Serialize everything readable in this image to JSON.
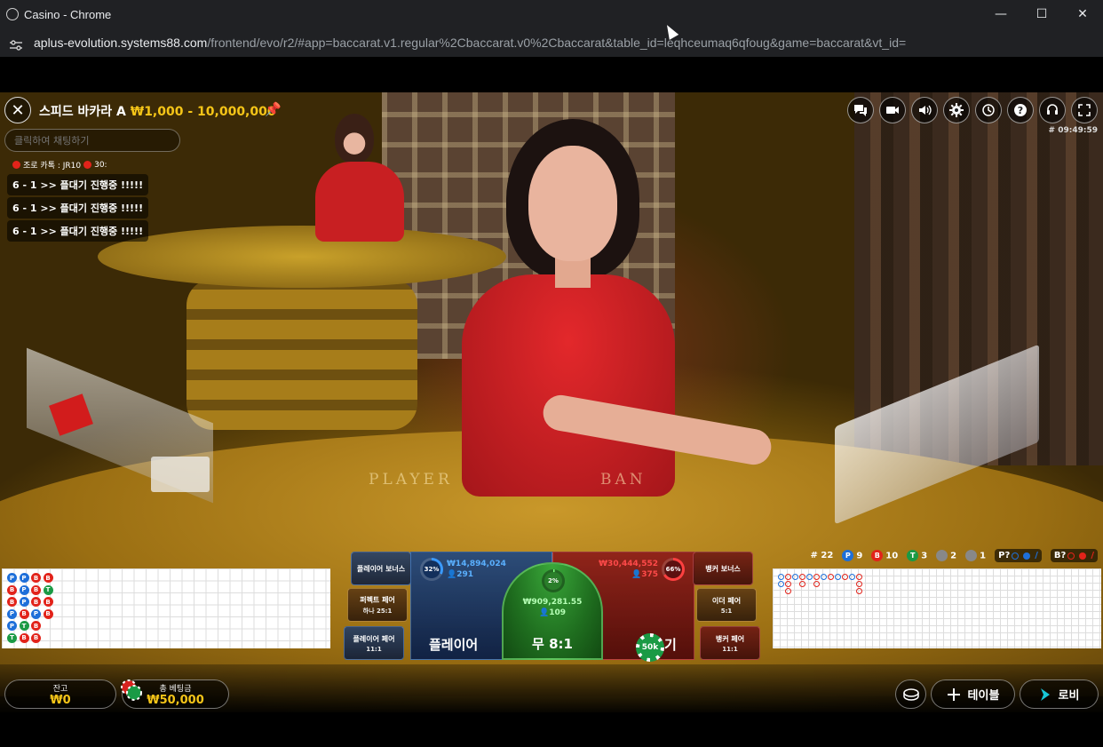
{
  "window": {
    "title": "Casino - Chrome",
    "minimize": "—",
    "maximize": "☐",
    "close": "✕"
  },
  "address": {
    "host": "aplus-evolution.systems88.com",
    "path": "/frontend/evo/r2/#app=baccarat.v1.regular%2Cbaccarat.v0%2Cbaccarat&table_id=leqhceumaq6qfoug&game=baccarat&vt_id="
  },
  "table": {
    "name": "스피드 바카라 A",
    "limits": "₩1,000 - 10,000,000",
    "game_id": "# 09:49:59"
  },
  "chat": {
    "placeholder": "클릭하여 채팅하기",
    "header_name": "조로 카톡 : JR10",
    "header_suffix": "30:",
    "messages": [
      "6 - 1 >> 플대기 진행중 !!!!!",
      "6 - 1 >> 플대기 진행중 !!!!!",
      "6 - 1 >> 플대기 진행중 !!!!!"
    ]
  },
  "toolbar_icons": [
    "chat-icon",
    "video-icon",
    "sound-icon",
    "settings-icon",
    "history-icon",
    "help-icon",
    "support-icon",
    "fullscreen-icon"
  ],
  "table_text": {
    "player": "PLAYER",
    "banker": "BAN"
  },
  "stats": {
    "round": "# 22",
    "player_count": "9",
    "banker_count": "10",
    "tie_count": "3",
    "player_pair": "2",
    "banker_pair": "1",
    "player_predict": "P?",
    "banker_predict": "B?",
    "p_letter": "P",
    "b_letter": "B",
    "t_letter": "T"
  },
  "bead_road": [
    [
      "P",
      "P",
      "B",
      "B"
    ],
    [
      "B",
      "P",
      "B",
      "T"
    ],
    [
      "B",
      "P",
      "B",
      "B"
    ],
    [
      "P",
      "B",
      "P",
      "B"
    ],
    [
      "P",
      "T",
      "B"
    ],
    [
      "T",
      "B",
      "B"
    ]
  ],
  "bets": {
    "player_bonus": "플레이어 보너스",
    "perfect_pair": "퍼펙트 페어",
    "perfect_pair_odds": "하나 25:1",
    "player_pair": "플레이어 페어",
    "player_pair_odds": "11:1",
    "banker_bonus": "뱅커 보너스",
    "either_pair": "이더 페어",
    "either_pair_odds": "5:1",
    "banker_pair": "뱅커 페어",
    "banker_pair_odds": "11:1",
    "player_label": "플레이어",
    "player_pct": "32%",
    "player_amount": "₩14,894,024",
    "player_bettors": "291",
    "tie_label": "무 8:1",
    "tie_pct": "2%",
    "tie_amount": "₩909,281.55",
    "tie_bettors": "109",
    "banker_label": "기",
    "banker_pct": "66%",
    "banker_amount": "₩30,444,552",
    "banker_bettors": "375",
    "chip_value": "50k",
    "player_pct_value": 32,
    "tie_pct_value": 2,
    "banker_pct_value": 66
  },
  "bottom": {
    "balance_label": "잔고",
    "balance_value": "₩0",
    "total_bet_label": "총 베팅금",
    "total_bet_value": "₩50,000",
    "tables_label": "테이블",
    "lobby_label": "로비"
  },
  "colors": {
    "player": "#1e6fd9",
    "banker": "#e2231a",
    "tie": "#1a9a45",
    "gold": "#f5c518"
  }
}
